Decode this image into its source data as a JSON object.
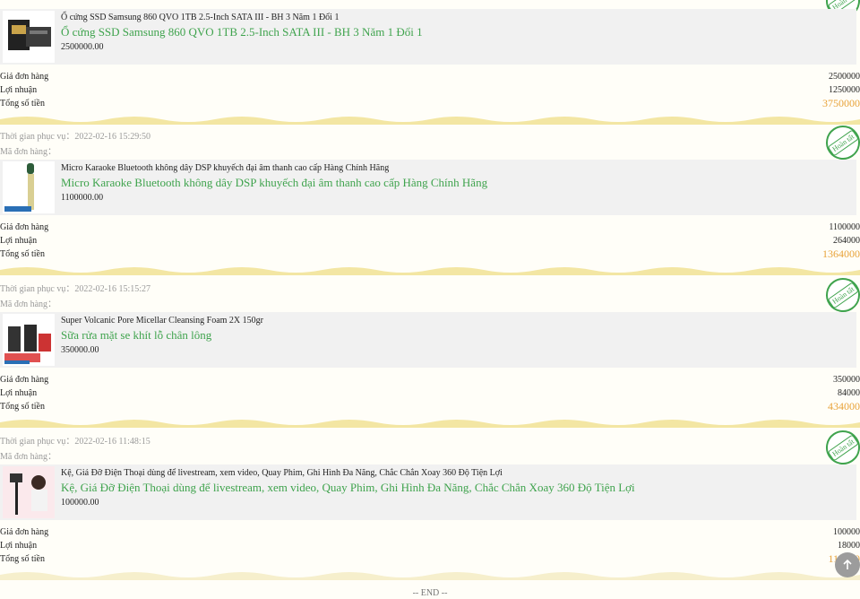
{
  "labels": {
    "service_time": "Thời gian phục vụ：",
    "order_code": "Mã đơn hàng：",
    "order_price": "Giá đơn hàng",
    "profit": "Lợi nhuận",
    "total": "Tổng số tiền",
    "end": "-- END --"
  },
  "stamp_text": "Hoàn tất",
  "orders": [
    {
      "time": "",
      "name_small": "Ổ cứng SSD Samsung 860 QVO 1TB 2.5-Inch SATA III - BH 3 Năm 1 Đổi 1",
      "name_big": "Ổ cứng SSD Samsung 860 QVO 1TB 2.5-Inch SATA III - BH 3 Năm 1 Đổi 1",
      "unit_price": "2500000.00",
      "order_price": "2500000",
      "profit": "1250000",
      "total": "3750000"
    },
    {
      "time": "2022-02-16 15:29:50",
      "name_small": "Micro Karaoke Bluetooth không dây DSP khuyếch đại âm thanh cao cấp Hàng Chính Hãng",
      "name_big": "Micro Karaoke Bluetooth không dây DSP khuyếch đại âm thanh cao cấp Hàng Chính Hãng",
      "unit_price": "1100000.00",
      "order_price": "1100000",
      "profit": "264000",
      "total": "1364000"
    },
    {
      "time": "2022-02-16 15:15:27",
      "name_small": "Super Volcanic Pore Micellar Cleansing Foam 2X 150gr",
      "name_big": "Sữa rửa mặt se khít lỗ chân lông",
      "unit_price": "350000.00",
      "order_price": "350000",
      "profit": "84000",
      "total": "434000"
    },
    {
      "time": "2022-02-16 11:48:15",
      "name_small": "Kệ, Giá Đỡ Điện Thoại dùng để livestream, xem video, Quay Phim, Ghi Hình Đa Năng, Chắc Chắn Xoay 360 Độ Tiện Lợi",
      "name_big": "Kệ, Giá Đỡ Điện Thoại dùng để livestream, xem video, Quay Phim, Ghi Hình Đa Năng, Chắc Chắn Xoay 360 Độ Tiện Lợi",
      "unit_price": "100000.00",
      "order_price": "100000",
      "profit": "18000",
      "total": "118000"
    }
  ],
  "colors": {
    "accent_green": "#3fa34d",
    "total_orange": "#e8a33a",
    "wave_yellow": "#f3e6a3"
  }
}
